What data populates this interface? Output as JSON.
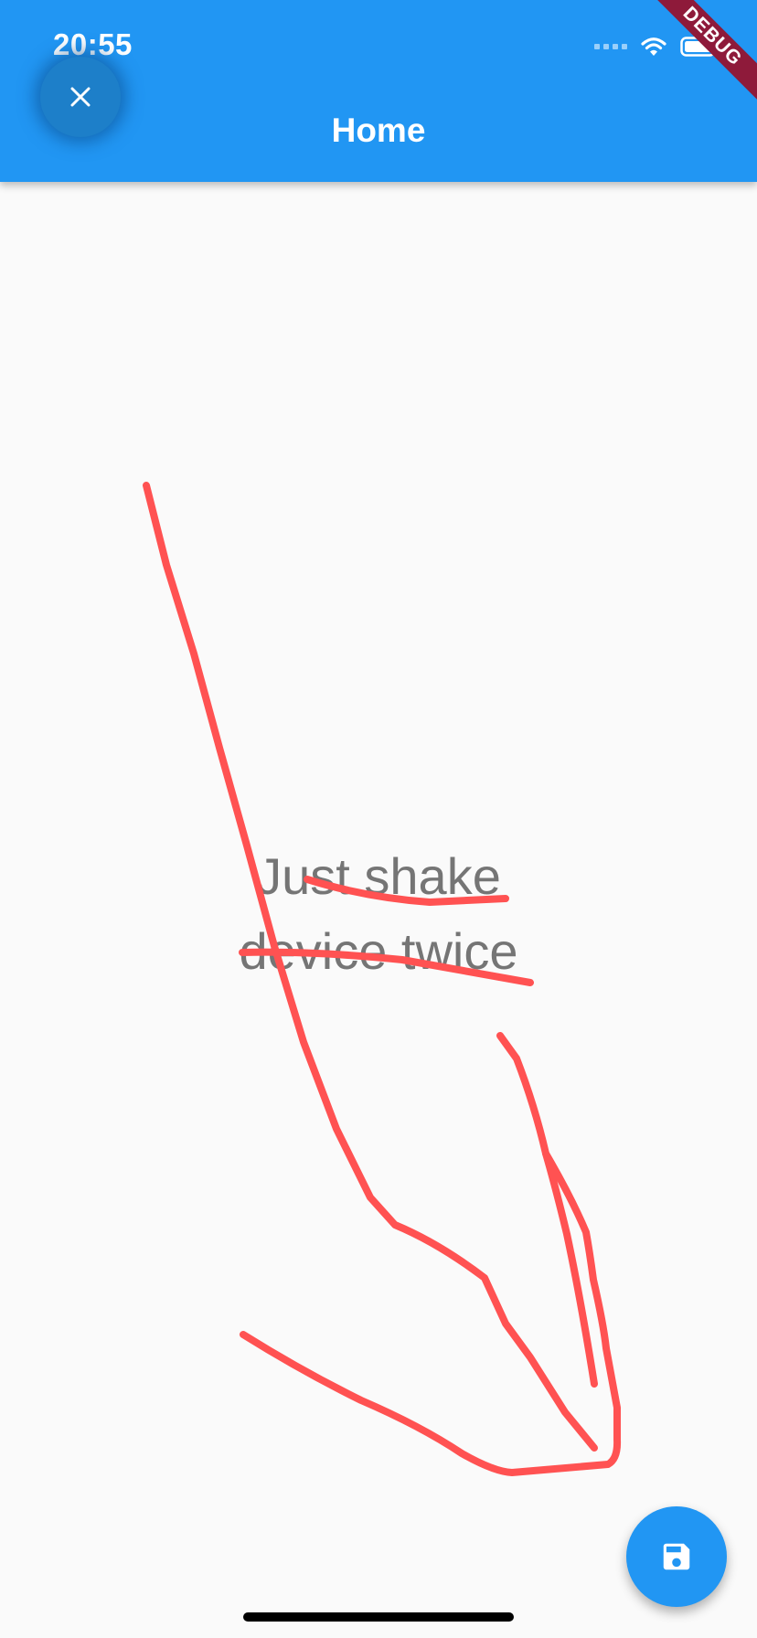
{
  "status_bar": {
    "time": "20:55",
    "icons": [
      "signal-icon",
      "wifi-icon",
      "battery-icon"
    ]
  },
  "app_bar": {
    "title": "Home",
    "close_icon": "close-icon",
    "color": "#2196F3"
  },
  "debug_banner": {
    "label": "DEBUG",
    "color": "#8E1A3A"
  },
  "body": {
    "line1": "Just shake",
    "line2": "device twice",
    "text_color": "#757575"
  },
  "drawing": {
    "stroke_color": "#FF5252"
  },
  "fab": {
    "icon": "save-icon",
    "color": "#2196F3"
  }
}
